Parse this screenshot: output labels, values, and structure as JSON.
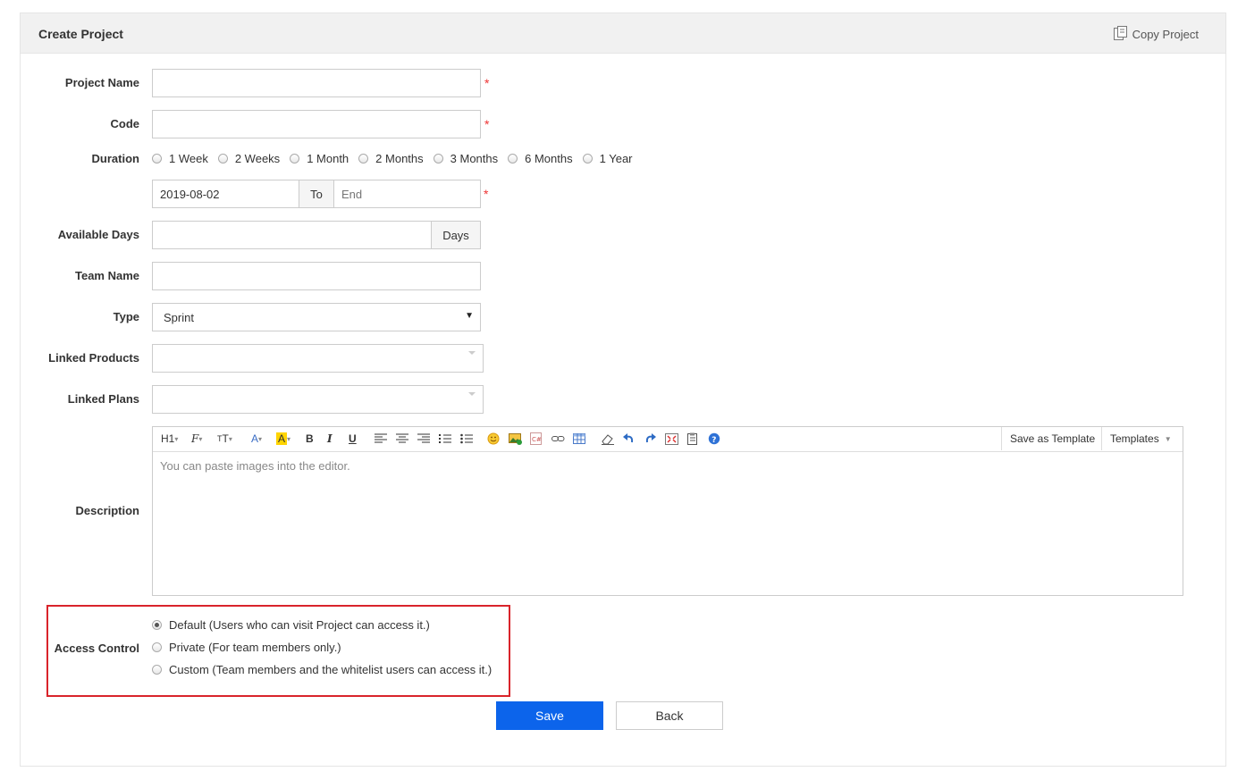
{
  "header": {
    "title": "Create Project",
    "copy_label": "Copy Project"
  },
  "form": {
    "project_name": {
      "label": "Project Name",
      "value": "",
      "required": "*"
    },
    "code": {
      "label": "Code",
      "value": "",
      "required": "*"
    },
    "duration": {
      "label": "Duration",
      "options": [
        "1 Week",
        "2 Weeks",
        "1 Month",
        "2 Months",
        "3 Months",
        "6 Months",
        "1 Year"
      ],
      "begin": "2019-08-02",
      "to_label": "To",
      "end_placeholder": "End",
      "required": "*"
    },
    "available_days": {
      "label": "Available Days",
      "value": "",
      "unit": "Days"
    },
    "team_name": {
      "label": "Team Name",
      "value": ""
    },
    "type": {
      "label": "Type",
      "selected": "Sprint"
    },
    "linked_products": {
      "label": "Linked Products"
    },
    "linked_plans": {
      "label": "Linked Plans"
    },
    "description": {
      "label": "Description",
      "placeholder": "You can paste images into the editor.",
      "toolbar": {
        "heading": "H1",
        "font": "F",
        "size": "T",
        "forecolor": "A",
        "highlight": "A",
        "bold": "B",
        "italic": "I",
        "underline": "U"
      },
      "save_template": "Save as Template",
      "templates": "Templates"
    },
    "access_control": {
      "label": "Access Control",
      "options": [
        "Default (Users who can visit Project can access it.)",
        "Private (For team members only.)",
        "Custom (Team members and the whitelist users can access it.)"
      ],
      "selected_index": 0
    }
  },
  "actions": {
    "save": "Save",
    "back": "Back"
  },
  "colors": {
    "primary": "#0c64eb",
    "required": "#e33333",
    "highlight_box": "#d9242b"
  }
}
